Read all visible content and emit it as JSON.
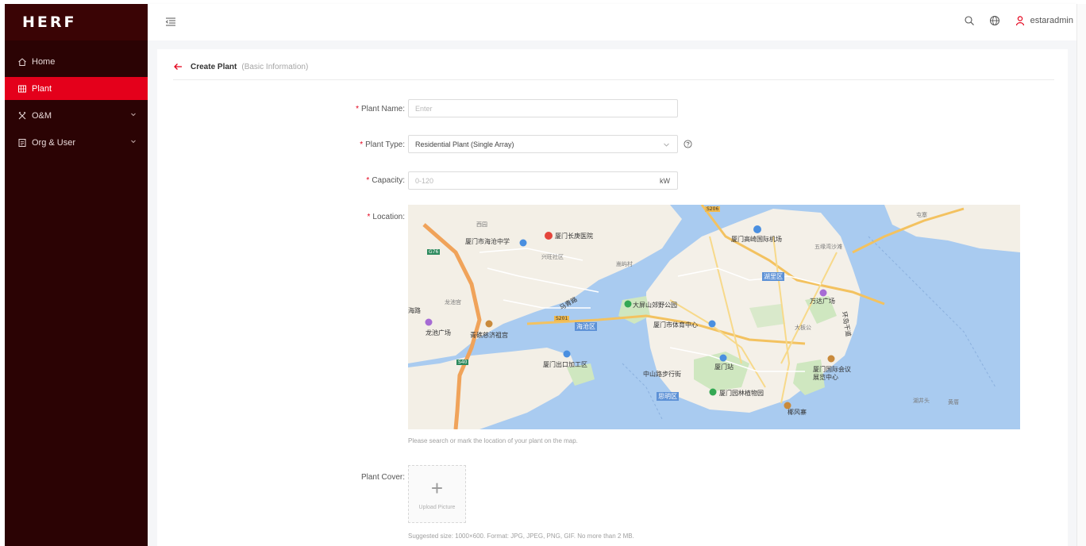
{
  "app": {
    "logo": "HERF"
  },
  "colors": {
    "brand": "#e4001b",
    "sidebar": "#2b0304",
    "sidebar_header": "#3a0405"
  },
  "sidebar": {
    "items": [
      {
        "label": "Home",
        "icon": "home-icon",
        "active": false
      },
      {
        "label": "Plant",
        "icon": "plant-grid-icon",
        "active": true
      },
      {
        "label": "O&M",
        "icon": "tools-icon",
        "active": false,
        "expandable": true
      },
      {
        "label": "Org & User",
        "icon": "org-icon",
        "active": false,
        "expandable": true
      }
    ]
  },
  "topbar": {
    "menu_fold_icon": "menu-fold-icon",
    "icons": [
      "search-icon",
      "globe-icon",
      "user-icon"
    ],
    "username": "estaradmin"
  },
  "page": {
    "title": "Create Plant",
    "subtitle": "(Basic Information)"
  },
  "form": {
    "plant_name": {
      "label": "Plant Name:",
      "placeholder": "Enter",
      "required": true
    },
    "plant_type": {
      "label": "Plant Type:",
      "value": "Residential Plant (Single Array)",
      "required": true
    },
    "capacity": {
      "label": "Capacity:",
      "placeholder": "0-120",
      "unit": "kW",
      "required": true
    },
    "location": {
      "label": "Location:",
      "required": true,
      "hint": "Please search or mark the location of your plant on the map."
    },
    "plant_cover": {
      "label": "Plant Cover:",
      "upload_symbol": "+",
      "upload_text": "Upload Picture",
      "hint": "Suggested size: 1000×600. Format: JPG, JPEG, PNG, GIF. No more than 2 MB."
    }
  },
  "map": {
    "labels": {
      "l1": "西园",
      "l2": "厦门市海沧中学",
      "l3": "厦门长庚医院",
      "l4": "兴旺社区",
      "l5": "嵩屿村",
      "l6": "厦门高崎国际机场",
      "l7": "五缘湾沙滩",
      "l8": "湖里区",
      "l9": "万达广场",
      "l10": "大屏山郊野公园",
      "l11": "厦门市体育中心",
      "l12": "大板公",
      "l13": "龙池宫",
      "l14": "龙池广场",
      "l15": "青礁慈济祖宫",
      "l16": "海沧区",
      "l17": "厦门出口加工区",
      "l18": "厦门站",
      "l19": "厦门国际会议展览中心",
      "l20": "中山路步行街",
      "l21": "思明区",
      "l22": "厦门园林植物园",
      "l23": "椰风寨",
      "l24": "湖井头",
      "l25": "黄厝",
      "l26": "屯寨",
      "l27": "马青路",
      "l28": "环岛干道",
      "l29": "海路",
      "r1": "G76",
      "r2": "S201",
      "r3": "S206",
      "r4": "S40"
    }
  }
}
